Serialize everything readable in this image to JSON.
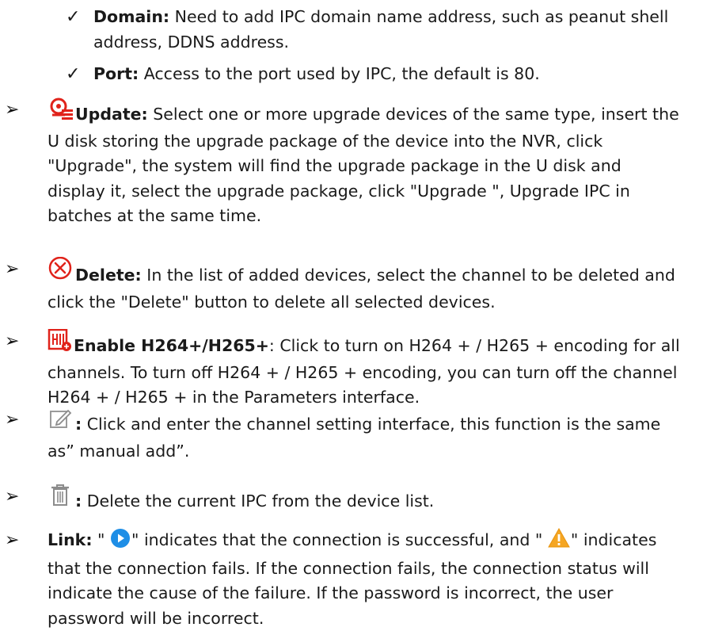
{
  "items": [
    {
      "term": "Domain:",
      "text": "Need to add IPC domain name address, such as peanut shell address, DDNS address."
    },
    {
      "term": "Port:",
      "text": "Access to the port used by IPC, the default is 80."
    },
    {
      "term": "Update:",
      "text": "Select one or more upgrade devices of the same type, insert the U disk storing the upgrade package of the device into the NVR, click \"Upgrade\", the system will find the upgrade package in the U disk and display it, select the upgrade package, click \"Upgrade \", Upgrade IPC in batches at the same time."
    },
    {
      "term": "Delete:",
      "text": "In the list of added devices, select the channel to be deleted and click the \"Delete\" button to delete all selected devices."
    },
    {
      "term": "Enable H264+/H265+",
      "text": ": Click to turn on H264 + / H265 + encoding for all channels. To turn off H264 + / H265 + encoding, you can turn off the channel H264 + / H265 + in the Parameters interface."
    },
    {
      "term": ":",
      "text": " Click and enter the channel setting interface, this function is the same as” manual add”."
    },
    {
      "term": ":",
      "text": " Delete the current IPC from the device list."
    },
    {
      "term": "Link:",
      "part1": "\"",
      "part2": "\" indicates that the connection is successful, and \"",
      "part3": "\" indicates that the connection fails. If the connection fails, the connection status will indicate the cause of the failure. If the password is incorrect, the user password will be incorrect."
    }
  ],
  "icons": {
    "bullet": "arrow-bullet-icon",
    "sub_bullet": "checkmark-icon",
    "update": "update-icon",
    "delete": "delete-circle-icon",
    "h264": "h264-plus-icon",
    "edit": "edit-icon",
    "trash": "trash-icon",
    "connected": "play-connected-icon",
    "warning": "warning-icon"
  },
  "colors": {
    "accent_red": "#e0231b",
    "connected_blue": "#1e8ee6",
    "warning_orange": "#f5a623",
    "icon_gray": "#8c8c8c",
    "text": "#1a1a1a"
  }
}
